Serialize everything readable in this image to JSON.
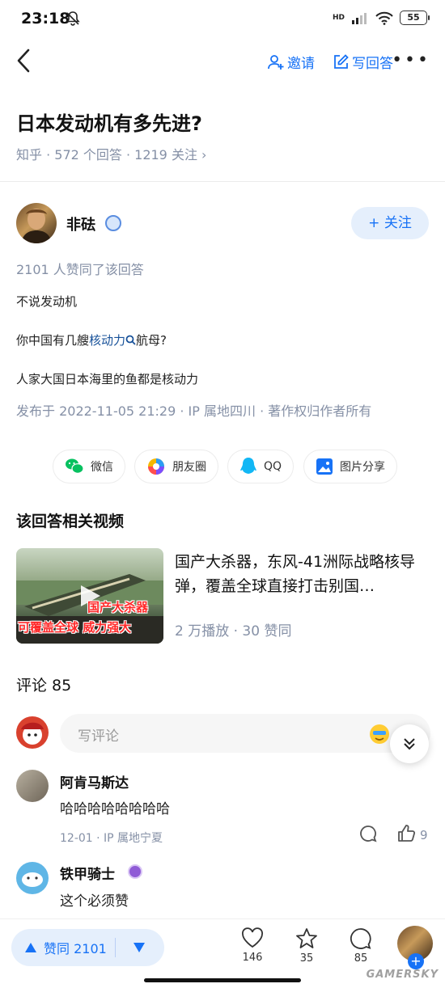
{
  "status_bar": {
    "time": "23:18",
    "battery": "55",
    "network": "HD"
  },
  "top_bar": {
    "invite_label": "邀请",
    "write_answer_label": "写回答",
    "more_label": "•••"
  },
  "question": {
    "title": "日本发动机有多先进?",
    "meta": "知乎 · 572 个回答 · 1219 关注 ›"
  },
  "answer": {
    "author": "非砝",
    "follow_label": "+ 关注",
    "likes_text": "2101 人赞同了该回答",
    "paragraph_1": "不说发动机",
    "paragraph_2_pre": "你中国有几艘",
    "paragraph_2_link": "核动力",
    "paragraph_2_post": "航母?",
    "paragraph_3": "人家大国日本海里的鱼都是核动力",
    "published": "发布于 2022-11-05 21:29 · IP 属地四川 · 著作权归作者所有"
  },
  "share": {
    "wechat": "微信",
    "moments": "朋友圈",
    "qq": "QQ",
    "image_share": "图片分享"
  },
  "related_video": {
    "section_title": "该回答相关视频",
    "title": "国产大杀器，东风-41洲际战略核导弹，覆盖全球直接打击别国…",
    "meta": "2 万播放 · 30 赞同",
    "thumb_caption_1": "国产大杀器",
    "thumb_caption_2": "可覆盖全球 威力强大"
  },
  "comments": {
    "section_title": "评论 85",
    "input_placeholder": "写评论",
    "items": [
      {
        "name": "阿肯马斯达",
        "text": "哈哈哈哈哈哈哈哈",
        "meta": "12-01 · IP 属地宁夏",
        "likes": "9"
      },
      {
        "name": "铁甲骑士",
        "text": "这个必须赞"
      }
    ]
  },
  "bottom_bar": {
    "vote_label": "赞同 2101",
    "like_count": "146",
    "star_count": "35",
    "comment_count": "85"
  },
  "watermark": "GAMERSKY",
  "colors": {
    "accent": "#1772f6",
    "meta": "#8590a6",
    "link": "#175199"
  }
}
